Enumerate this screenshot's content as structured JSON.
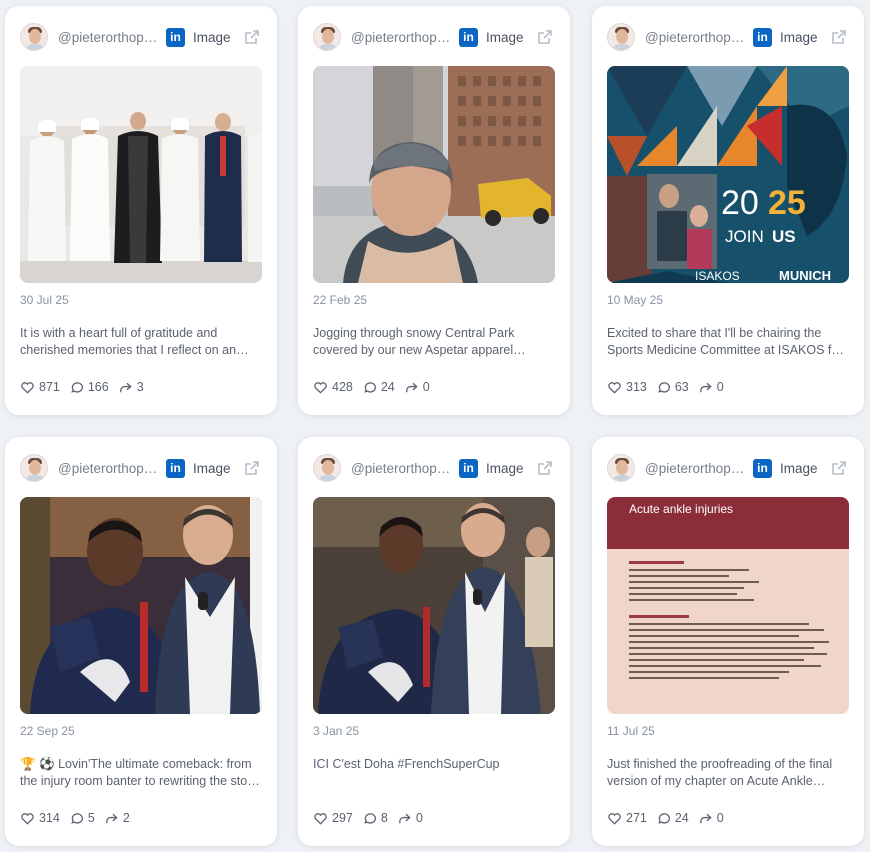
{
  "colors": {
    "accent": "#0a66c2",
    "text": "#5b6270",
    "muted": "#8a93a3",
    "background": "#eef1f5"
  },
  "icons": {
    "platform": "linkedin-icon",
    "external": "external-link-icon",
    "like": "heart-icon",
    "comment": "comment-icon",
    "share": "share-icon"
  },
  "posts": [
    {
      "handle": "@pieterorthopaedics",
      "platform_letters": "in",
      "type": "Image",
      "date": "30 Jul 25",
      "caption": "It is with a heart full of gratitude and cherished memories that I reflect on an incredible journey",
      "likes": "871",
      "comments": "166",
      "shares": "3"
    },
    {
      "handle": "@pieterorthopaedics",
      "platform_letters": "in",
      "type": "Image",
      "date": "22 Feb 25",
      "caption": "Jogging through snowy Central Park covered by our new Aspetar apparel enjoying the cold morning",
      "likes": "428",
      "comments": "24",
      "shares": "0"
    },
    {
      "handle": "@pieterorthopaedics",
      "platform_letters": "in",
      "type": "Image",
      "date": "10 May 25",
      "caption": "Excited to share that I'll be chairing the Sports Medicine Committee at ISAKOS for the next congress",
      "likes": "313",
      "comments": "63",
      "shares": "0",
      "media_text": {
        "year_a": "20",
        "year_b": "25",
        "join_a": "JOIN",
        "join_b": "US",
        "org": "ISAKOS",
        "city": "MUNICH"
      }
    },
    {
      "handle": "@pieterorthopaedics",
      "platform_letters": "in",
      "type": "Image",
      "date": "22 Sep 25",
      "caption": "🏆 ⚽ Lovin'The ultimate comeback: from the injury room banter to rewriting the story of the season",
      "likes": "314",
      "comments": "5",
      "shares": "2"
    },
    {
      "handle": "@pieterorthopaedics",
      "platform_letters": "in",
      "type": "Image",
      "date": "3 Jan 25",
      "caption": "ICI C'est Doha #FrenchSuperCup",
      "likes": "297",
      "comments": "8",
      "shares": "0"
    },
    {
      "handle": "@pieterorthopaedics",
      "platform_letters": "in",
      "type": "Image",
      "date": "11 Jul 25",
      "caption": "Just finished the proofreading of the final version of my chapter on Acute Ankle Injuries",
      "likes": "271",
      "comments": "24",
      "shares": "0",
      "media_text": {
        "title": "Acute ankle injuries"
      }
    }
  ]
}
